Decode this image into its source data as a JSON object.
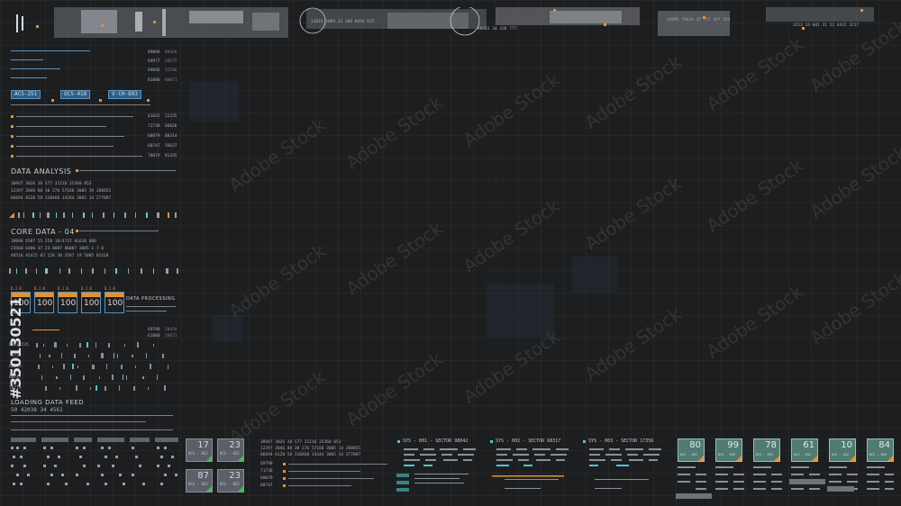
{
  "top_strip": {
    "readout_a": "21619  1889  33  108  8692  625",
    "readout_b": "60261  34  438  777",
    "readout_c": "32695  76634  37  757  447  353",
    "readout_d": "3213  19  001  31  21  4432  3217"
  },
  "left_panel": {
    "number_table": [
      {
        "a": "89096",
        "b": "89426"
      },
      {
        "a": "69977",
        "b": "58575"
      },
      {
        "a": "69046",
        "b": "52546"
      },
      {
        "a": "81888",
        "b": "88071"
      }
    ],
    "tags": [
      "ACS-251",
      "OCS-418",
      "V-CH-893"
    ],
    "pair_values": [
      {
        "a": "81032",
        "b": "22335"
      },
      {
        "a": "71738",
        "b": "66026"
      },
      {
        "a": "60079",
        "b": "80314"
      },
      {
        "a": "60747",
        "b": "56627"
      },
      {
        "a": "78079",
        "b": "81435"
      }
    ],
    "data_analysis": {
      "title": "DATA ANALYSIS",
      "rows": [
        "30947  3026  38  S77  31116  35360  853",
        "12397  2046  88  30  276  57168  3005  19  288855",
        "86694  8120  58  310468  14344  3065  14  277087"
      ]
    },
    "core_data": {
      "title": "CORE DATA - 04",
      "rows": [
        "38096  6507  55  258  18/4737  81618  880",
        "23568  6406  37  23  8087  86087  3885  1  7  8",
        "48516  81415  02  128  30  3587  19  5085  81418"
      ]
    },
    "docs": [
      {
        "head": "D.I.K",
        "value": "100"
      },
      {
        "head": "D.I.K",
        "value": "100"
      },
      {
        "head": "D.I.K",
        "value": "100"
      },
      {
        "head": "D.I.K",
        "value": "100"
      },
      {
        "head": "D.I.K",
        "value": "100"
      }
    ],
    "data_processing": "DATA PROCESSING",
    "mid_numbers": [
      {
        "a": "69798",
        "b": "58454"
      },
      {
        "a": "61888",
        "b": "58071"
      }
    ],
    "row_labels": [
      "81232235",
      "71732",
      "60279",
      "60747",
      "70779"
    ],
    "feed_title": "LOADING DATA FEED",
    "feed_value": "50  42038  34  4561"
  },
  "watermark": {
    "text": "Adobe Stock",
    "id": "#350130521"
  },
  "bottom": {
    "mini_cards": [
      {
        "value": "17",
        "label": "OCS - 052"
      },
      {
        "value": "23",
        "label": "OCS - 052"
      },
      {
        "value": "87",
        "label": "OCS - 052"
      },
      {
        "value": "23",
        "label": "OCS - 052"
      }
    ],
    "code_rows": [
      "30947  3026  38  S77  31116  35360  853",
      "12397  2046  88  30  276  57168  3005  14  288855",
      "86694  8120  58  310468  14344  3065  14  277087"
    ],
    "slider_values": [
      "69798",
      "71738",
      "60079",
      "60747"
    ],
    "sectors": [
      {
        "title": "SYS - 001 - SECTOR 98042"
      },
      {
        "title": "SYS - 002 - SECTOR 68317"
      },
      {
        "title": "SYS - 003 - SECTOR 17356"
      }
    ],
    "teal_cards": [
      {
        "value": "80",
        "label": "OCS - 052"
      },
      {
        "value": "99",
        "label": "OCS - 052"
      },
      {
        "value": "78",
        "label": "OCS - 052"
      },
      {
        "value": "61",
        "label": "OCS - 052"
      },
      {
        "value": "10",
        "label": "OCS - 052"
      },
      {
        "value": "84",
        "label": "OCS - 052"
      }
    ]
  },
  "colors": {
    "accent": "#e6922c",
    "tag_blue": "#2f5d80",
    "cyan": "#4fc4cf",
    "background": "#1d1e20"
  }
}
